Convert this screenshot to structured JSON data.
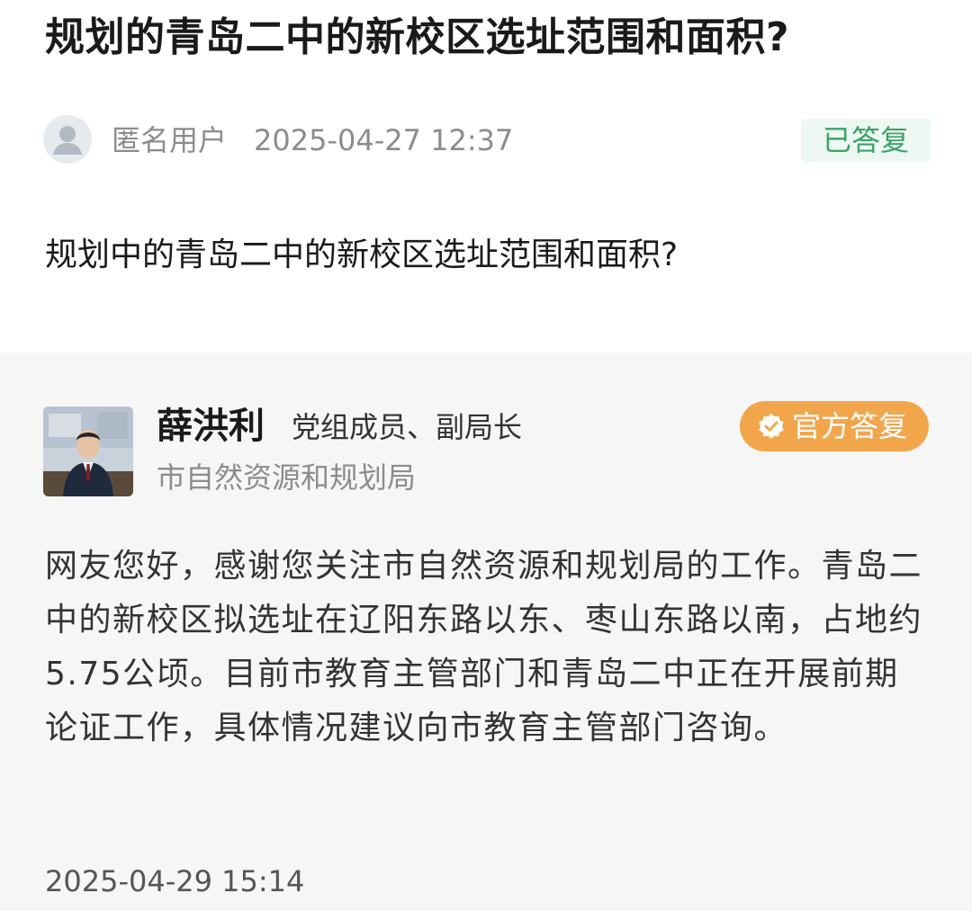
{
  "question": {
    "title": "规划的青岛二中的新校区选址范围和面积?",
    "asker_name": "匿名用户",
    "asked_time": "2025-04-27 12:37",
    "status": "已答复",
    "body": "规划中的青岛二中的新校区选址范围和面积?"
  },
  "answer": {
    "official_name": "薛洪利",
    "official_title": "党组成员、副局长",
    "department": "市自然资源和规划局",
    "badge": "官方答复",
    "body": "网友您好，感谢您关注市自然资源和规划局的工作。青岛二中的新校区拟选址在辽阳东路以东、枣山东路以南，占地约5.75公顷。目前市教育主管部门和青岛二中正在开展前期论证工作，具体情况建议向市教育主管部门咨询。",
    "answered_time": "2025-04-29 15:14"
  },
  "colors": {
    "status_green": "#3aa36a",
    "status_bg": "#eef8f2",
    "badge_orange": "#f2a64b",
    "answer_bg": "#f6f6f6"
  },
  "icons": {
    "asker_avatar": "user-avatar-icon",
    "official_badge": "verified-check-icon"
  }
}
